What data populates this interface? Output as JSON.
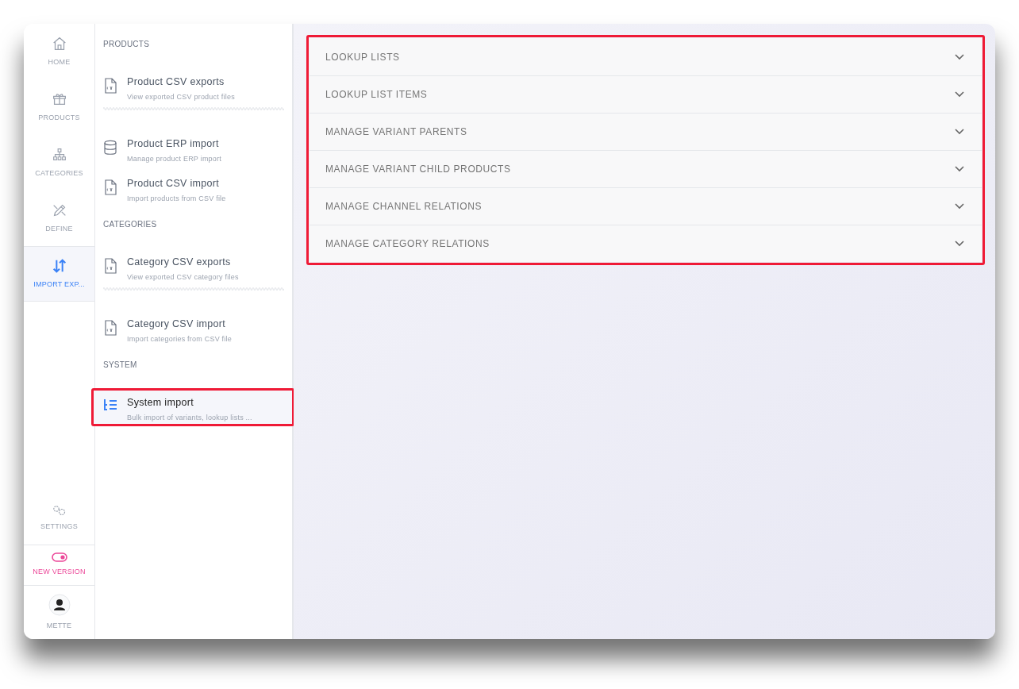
{
  "nav": {
    "items": [
      {
        "label": "HOME",
        "kind": "home",
        "selected": false
      },
      {
        "label": "PRODUCTS",
        "kind": "box",
        "selected": false
      },
      {
        "label": "CATEGORIES",
        "kind": "tree",
        "selected": false
      },
      {
        "label": "DEFINE",
        "kind": "pencil",
        "selected": false
      },
      {
        "label": "IMPORT EXP...",
        "kind": "arrows",
        "selected": true
      }
    ],
    "bottom": [
      {
        "label": "SETTINGS",
        "kind": "settings"
      },
      {
        "label": "NEW VERSION",
        "kind": "toggle",
        "on": true
      },
      {
        "label": "METTE",
        "kind": "user"
      }
    ]
  },
  "subnav": {
    "sections": [
      {
        "title": "PRODUCTS",
        "items": [
          {
            "title": "Product CSV exports",
            "subtitle": "View exported CSV product files",
            "kind": "csv",
            "selected": false,
            "highlighted": false,
            "wavy_divider_after": true
          },
          {
            "title": "Product ERP import",
            "subtitle": "Manage product ERP import",
            "kind": "database",
            "selected": false,
            "highlighted": false,
            "wavy_divider_after": false
          },
          {
            "title": "Product CSV import",
            "subtitle": "Import products from CSV file",
            "kind": "csv",
            "selected": false,
            "highlighted": false,
            "wavy_divider_after": false
          }
        ]
      },
      {
        "title": "CATEGORIES",
        "items": [
          {
            "title": "Category CSV exports",
            "subtitle": "View exported CSV category files",
            "kind": "csv",
            "selected": false,
            "highlighted": false,
            "wavy_divider_after": true
          },
          {
            "title": "Category CSV import",
            "subtitle": "Import categories from CSV file",
            "kind": "csv",
            "selected": false,
            "highlighted": false,
            "wavy_divider_after": false
          }
        ]
      },
      {
        "title": "SYSTEM",
        "items": [
          {
            "title": "System import",
            "subtitle": "Bulk import of variants, lookup lists ...",
            "kind": "list",
            "selected": true,
            "highlighted": true,
            "wavy_divider_after": false
          }
        ]
      }
    ]
  },
  "accordion": {
    "highlighted": true,
    "panels": [
      {
        "title": "LOOKUP LISTS",
        "expanded": false
      },
      {
        "title": "LOOKUP LIST ITEMS",
        "expanded": false
      },
      {
        "title": "MANAGE VARIANT PARENTS",
        "expanded": false
      },
      {
        "title": "MANAGE VARIANT CHILD PRODUCTS",
        "expanded": false
      },
      {
        "title": "MANAGE CHANNEL RELATIONS",
        "expanded": false
      },
      {
        "title": "MANAGE CATEGORY RELATIONS",
        "expanded": false
      }
    ]
  }
}
